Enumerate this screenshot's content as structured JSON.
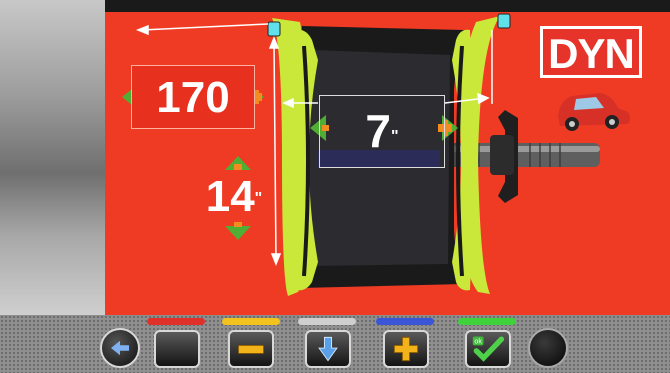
{
  "badges": {
    "mode": "DYN",
    "width": "170",
    "diameter": "14",
    "diameter_unit": "\"",
    "offset": "7",
    "offset_unit": "\""
  },
  "icons": {
    "left_arrows": "chevron-left-icon",
    "right_arrows": "chevron-right-icon",
    "up_arrow": "chevron-up-icon",
    "down_arrow": "chevron-down-icon",
    "car": "car-icon",
    "back": "arrow-left-icon",
    "ok": "checkmark-icon",
    "ok_text": "ok"
  },
  "toolbar": {
    "buttons": [
      {
        "name": "back-button",
        "icon": "arrow-left-icon"
      },
      {
        "name": "blank-button",
        "bar_color": "#e0302a"
      },
      {
        "name": "minus-button",
        "bar_color": "#f2c21f",
        "icon": "minus-icon"
      },
      {
        "name": "down-button",
        "bar_color": "#cfcfcf",
        "icon": "arrow-down-icon"
      },
      {
        "name": "plus-button",
        "bar_color": "#3b55d8",
        "icon": "plus-icon"
      },
      {
        "name": "confirm-button",
        "bar_color": "#3fd23c",
        "icon": "checkmark-icon"
      },
      {
        "name": "circle-button",
        "icon": "circle-icon"
      }
    ]
  },
  "colors": {
    "background_red": "#ef3b24",
    "rim_yellow": "#c9e83a",
    "arrow_green": "#4fae33",
    "arrow_orange": "#f28c1f"
  }
}
